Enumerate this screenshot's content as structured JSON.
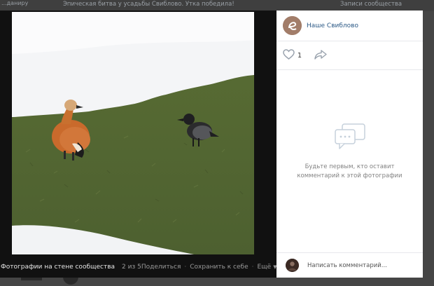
{
  "background": {
    "left_stub": "...даниру",
    "post_title": "Эпическая битва у усадьбы Свиблово. Утка победила!",
    "right_stub": "Записи сообщества"
  },
  "viewer": {
    "album_label": "Фотографии на стене сообщества",
    "counter": "2 из 5",
    "actions": {
      "share": "Поделиться",
      "save": "Сохранить к себе",
      "more": "Ещё"
    }
  },
  "panel": {
    "group_name": "Наше Свиблово",
    "likes": "1",
    "empty_text_line1": "Будьте первым, кто оставит",
    "empty_text_line2": "комментарий к этой фотографии",
    "comment_placeholder": "Написать комментарий..."
  },
  "colors": {
    "link": "#2a5885",
    "viewer_bg": "#111111",
    "muted": "#828282"
  },
  "icons": {
    "like": "heart-icon",
    "share": "share-arrow-icon",
    "comments": "chat-bubbles-icon",
    "more": "chevron-down-icon"
  }
}
